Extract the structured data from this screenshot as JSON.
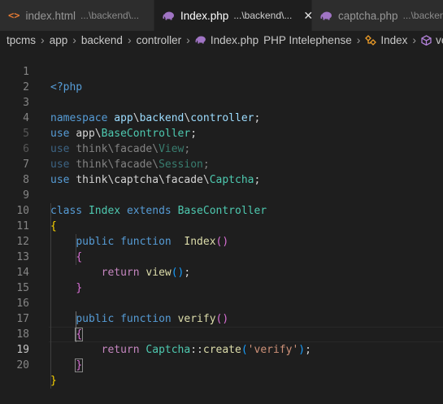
{
  "tabs": [
    {
      "label": "index.html",
      "description": "...\\backend\\...",
      "icon": "html-file-icon",
      "active": false
    },
    {
      "label": "Index.php",
      "description": "...\\backend\\...",
      "icon": "php-elephant-icon",
      "active": true,
      "close": "✕"
    },
    {
      "label": "captcha.php",
      "description": "...\\backend\\...",
      "icon": "php-elephant-icon",
      "active": false
    }
  ],
  "breadcrumb": {
    "items": [
      "tpcms",
      "app",
      "backend",
      "controller",
      "Index.php",
      "PHP Intelephense",
      "Index",
      "ve"
    ],
    "separator": "›"
  },
  "editor": {
    "line_numbers": [
      "1",
      "2",
      "3",
      "4",
      "5",
      "6",
      "7",
      "8",
      "9",
      "10",
      "11",
      "12",
      "13",
      "14",
      "15",
      "16",
      "17",
      "18",
      "19",
      "20"
    ],
    "current_line": "19"
  },
  "colors": {
    "editor_background": "#1e1e1e",
    "keyword": "#569cd6",
    "class_name": "#4ec9b0",
    "function_name": "#dcdcaa",
    "namespace": "#9cdcfe",
    "string": "#ce9178",
    "bracket_level1": "#ffd700",
    "bracket_level2": "#da70d6",
    "bracket_level3": "#179fff"
  }
}
